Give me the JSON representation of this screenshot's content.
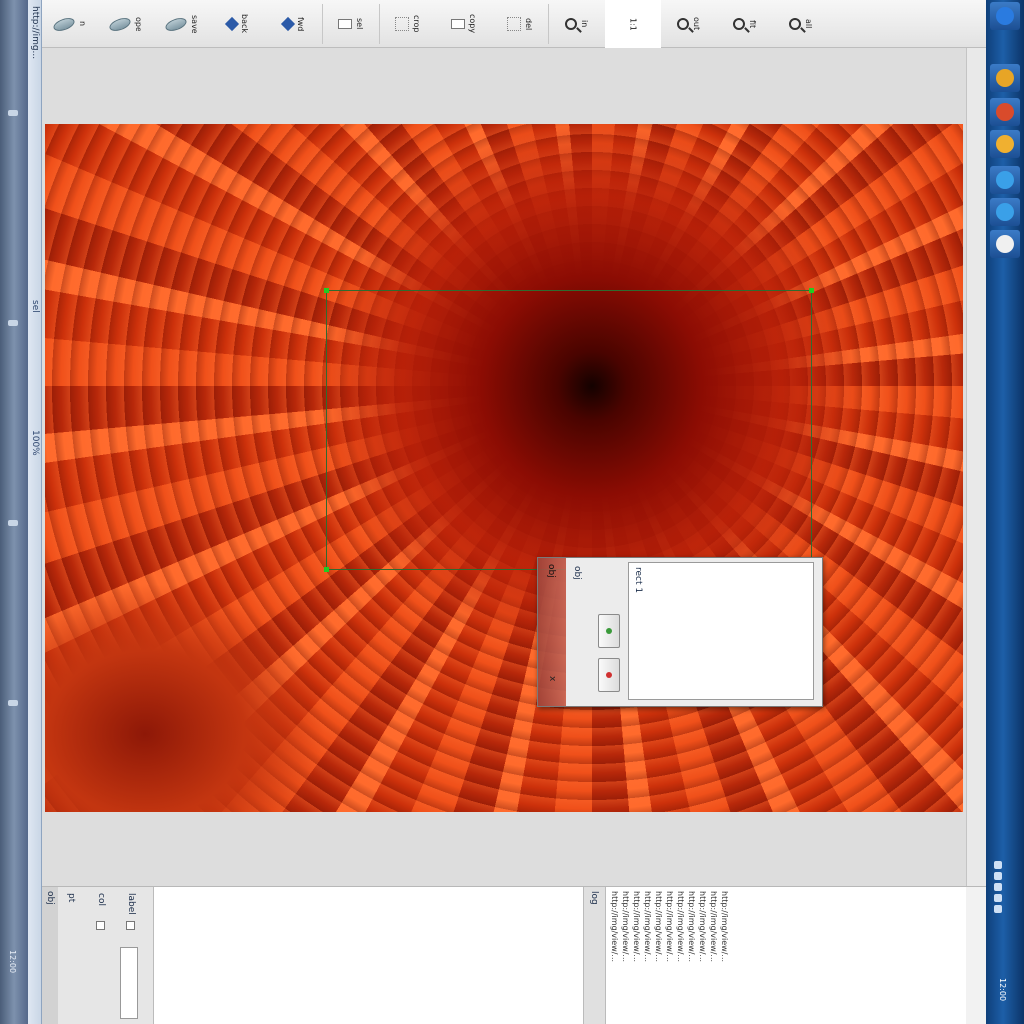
{
  "colors": {
    "accent": "#1d5fa8",
    "handle": "#22cc22",
    "selection_border": "#2f6b2f",
    "photo_main": "#e2461a"
  },
  "left_strip": {
    "path": "http://img...",
    "selection_text": "sel",
    "zoom_text": "100%",
    "clock": "12:00"
  },
  "toolbar": {
    "items": [
      {
        "icon": "disk-icon",
        "label": "n"
      },
      {
        "icon": "disk-icon",
        "label": "ope"
      },
      {
        "icon": "disk-icon",
        "label": "save"
      },
      {
        "icon": "diamond-icon",
        "label": "back"
      },
      {
        "icon": "diamond-icon",
        "label": "fwd"
      },
      {
        "icon": "rect-icon",
        "label": "sel"
      },
      {
        "icon": "grid-icon",
        "label": "crop"
      },
      {
        "icon": "rect-icon",
        "label": "copy"
      },
      {
        "icon": "grid-icon",
        "label": "del"
      },
      {
        "icon": "zoom-icon",
        "label": "in"
      },
      {
        "icon": "zoom-icon",
        "label": "1:1"
      },
      {
        "icon": "zoom-icon",
        "label": "out"
      },
      {
        "icon": "zoom-icon",
        "label": "fit"
      },
      {
        "icon": "zoom-icon",
        "label": "all"
      }
    ],
    "active_label": "1:1"
  },
  "dialog": {
    "title": "obj",
    "close": "x",
    "label": "obj",
    "entries": "rect 1",
    "button_add": "+",
    "button_del": "-"
  },
  "bottom": {
    "props_title": "obj",
    "prop1": "pt",
    "prop2": "col",
    "prop3": "label",
    "log_title": "log",
    "log_lines": [
      "http://img/view/...",
      "http://img/view/...",
      "http://img/view/...",
      "http://img/view/...",
      "http://img/view/...",
      "http://img/view/...",
      "http://img/view/...",
      "http://img/view/...",
      "http://img/view/...",
      "http://img/view/...",
      "http://img/view/..."
    ]
  },
  "taskbar": {
    "buttons": [
      {
        "icon": "browser-icon",
        "color": "#2a7be0"
      },
      {
        "icon": "folder-icon",
        "color": "#e7a526"
      },
      {
        "icon": "chrome-icon",
        "color": "#d94b2b"
      },
      {
        "icon": "app-icon",
        "color": "#f0b030"
      },
      {
        "icon": "ie-icon",
        "color": "#3aa0e8"
      },
      {
        "icon": "ie-icon",
        "color": "#3aa0e8"
      },
      {
        "icon": "window-icon",
        "color": "#f0f0f0"
      }
    ],
    "clock": "12:00"
  }
}
